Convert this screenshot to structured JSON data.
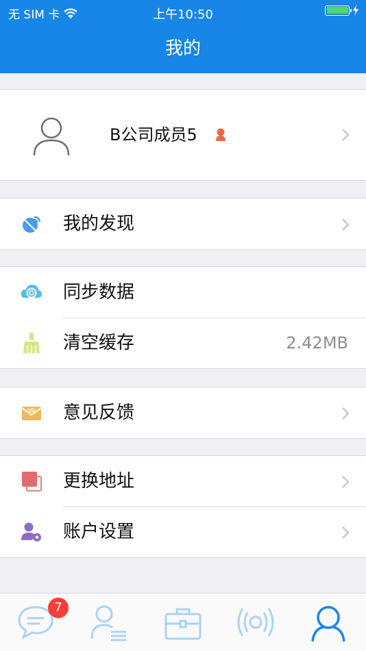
{
  "status_bar": {
    "carrier": "无 SIM 卡",
    "time": "上午10:50",
    "battery_level": 1.0
  },
  "nav": {
    "title": "我的"
  },
  "profile": {
    "name": "B公司成员5"
  },
  "menu": {
    "discover": {
      "label": "我的发现"
    },
    "sync": {
      "label": "同步数据"
    },
    "clear_cache": {
      "label": "清空缓存",
      "value": "2.42MB"
    },
    "feedback": {
      "label": "意见反馈"
    },
    "change_address": {
      "label": "更换地址"
    },
    "account_settings": {
      "label": "账户设置"
    }
  },
  "tabbar": {
    "messages": {
      "icon": "chat-bubble-icon",
      "badge": "7"
    },
    "contacts": {
      "icon": "contacts-icon"
    },
    "work": {
      "icon": "briefcase-icon"
    },
    "broadcast": {
      "icon": "signal-icon"
    },
    "me": {
      "icon": "user-icon",
      "selected": true
    }
  },
  "colors": {
    "brand_blue": "#1786e6",
    "badge_red": "#fc3d39",
    "tab_inactive": "#a9d2f5",
    "tab_active": "#1786e6"
  }
}
